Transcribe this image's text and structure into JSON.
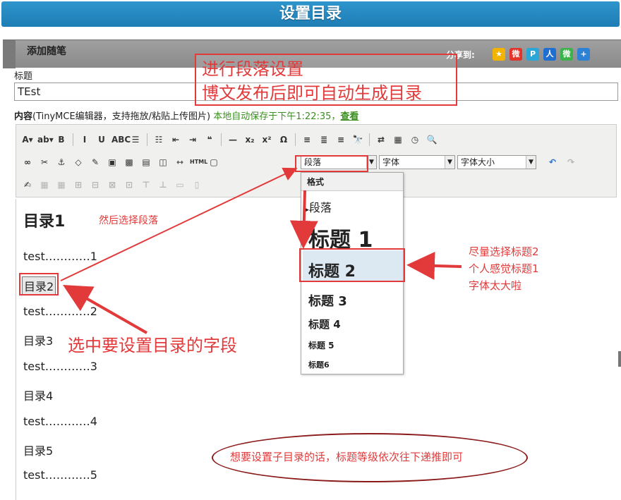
{
  "page_title": "设置目录",
  "header": {
    "add_essay": "添加随笔",
    "share_label": "分享到:",
    "share_icons": [
      {
        "name": "qzone-icon",
        "glyph": "★",
        "color": "#f2b400"
      },
      {
        "name": "weibo-icon",
        "glyph": "微",
        "color": "#e2342a"
      },
      {
        "name": "tencent-weibo-icon",
        "glyph": "P",
        "color": "#2aa7d6"
      },
      {
        "name": "renren-icon",
        "glyph": "人",
        "color": "#1e6fd0"
      },
      {
        "name": "wechat-icon",
        "glyph": "微",
        "color": "#3bb34a"
      },
      {
        "name": "more-share-icon",
        "glyph": "+",
        "color": "#2d82d6"
      }
    ]
  },
  "form": {
    "title_label": "标题",
    "title_value": "TEst",
    "content_label": "内容",
    "content_hint": "(TinyMCE编辑器，支持拖放/粘贴上传图片)",
    "autosave": "本地自动保存于下午1:22:35，",
    "autosave_link": "查看"
  },
  "toolbar": {
    "row1": [
      "A▾",
      "ab▾",
      "B",
      "I",
      "U",
      "ABC",
      "☰",
      "☷",
      "⇤",
      "⇥",
      "❝",
      "—",
      "x₂",
      "x²",
      "Ω",
      "≡",
      "≣",
      "≡",
      "🔭",
      "⇄",
      "▦",
      "◷",
      "🔍"
    ],
    "row2": [
      "∞",
      "✂",
      "⚓",
      "◇",
      "✎",
      "▣",
      "▩",
      "▤",
      "◫",
      "⇿",
      "HTML",
      "▢"
    ],
    "row3": [
      "✍",
      "▦",
      "▦",
      "⊞",
      "⊟",
      "⊠",
      "⊡",
      "⊤",
      "⊥",
      "▭",
      "▯"
    ],
    "paragraph_select": "段落",
    "font_select": "字体",
    "size_select": "字体大小"
  },
  "editor": {
    "lines": [
      "目录1",
      "test…………1",
      "目录2",
      "test…………2",
      "目录3",
      "test…………3",
      "目录4",
      "test…………4",
      "目录5",
      "test…………5"
    ]
  },
  "format_dropdown": {
    "header": "格式",
    "items": [
      "段落",
      "标题 1",
      "标题 2",
      "标题 3",
      "标题 4",
      "标题 5",
      "标题6"
    ]
  },
  "annotations": {
    "paragraph_setting_1": "进行段落设置",
    "paragraph_setting_2": "博文发布后即可自动生成目录",
    "then_select": "然后选择段落",
    "select_field": "选中要设置目录的字段",
    "heading_tip_1": "尽量选择标题2",
    "heading_tip_2": "个人感觉标题1",
    "heading_tip_3": "字体太大啦",
    "subdir_tip": "想要设置子目录的话，标题等级依次往下递推即可"
  },
  "colors": {
    "accent": "#1e7db5",
    "annotation_red": "#e23a3a",
    "oval": "#8b1a1a"
  }
}
